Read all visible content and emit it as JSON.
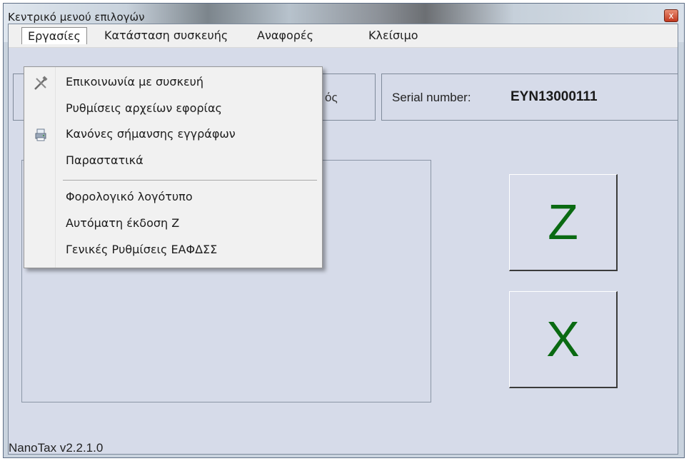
{
  "window": {
    "title": "Κεντρικό μενού επιλογών",
    "close_glyph": "x"
  },
  "menubar": {
    "items": [
      {
        "label": "Εργασίες"
      },
      {
        "label": "Κατάσταση συσκευής"
      },
      {
        "label": "Αναφορές"
      },
      {
        "label": "Κλείσιμο"
      }
    ]
  },
  "dropdown": {
    "items": [
      {
        "label": "Επικοινωνία με συσκευή",
        "icon": "tools-icon"
      },
      {
        "label": "Ρυθμίσεις αρχείων εφορίας"
      },
      {
        "label": "Κανόνες σήμανσης εγγράφων",
        "icon": "printer-icon"
      },
      {
        "label": "Παραστατικά"
      },
      {
        "label": "Φορολογικό λογότυπο"
      },
      {
        "label": "Αυτόματη έκδοση Ζ"
      },
      {
        "label": "Γενικές Ρυθμίσεις ΕΑΦΔΣΣ"
      }
    ]
  },
  "device": {
    "partial_label": "ός",
    "serial_label": "Serial number:",
    "serial_value": "EYN13000111"
  },
  "buttons": {
    "z_label": "Z",
    "x_label": "X"
  },
  "status": {
    "version": "NanoTax v2.2.1.0"
  },
  "colors": {
    "button_text": "#0a6a12",
    "client_bg": "#d6dbe9"
  }
}
